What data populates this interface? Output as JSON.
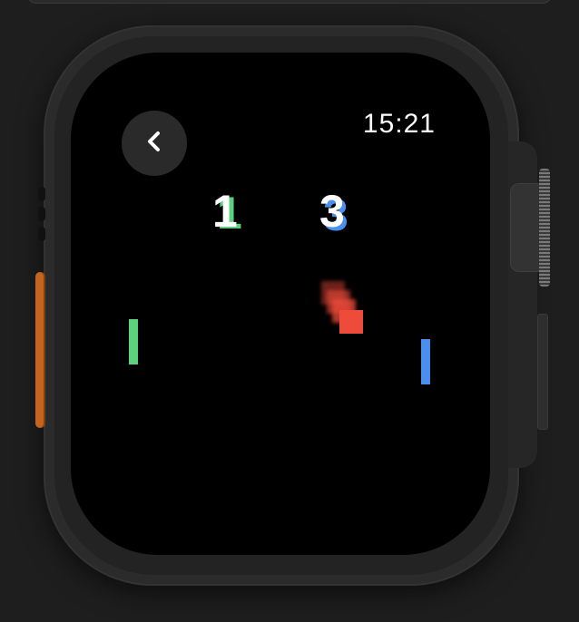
{
  "status_bar": {
    "time": "15:21"
  },
  "navigation": {
    "back_icon": "chevron-left-icon"
  },
  "game": {
    "score_left": "1",
    "score_right": "3",
    "left_paddle_color": "#5cd07c",
    "right_paddle_color": "#4a8eee",
    "ball_color": "#ef4b3a"
  },
  "device": {
    "accent_color": "#c4641d"
  }
}
